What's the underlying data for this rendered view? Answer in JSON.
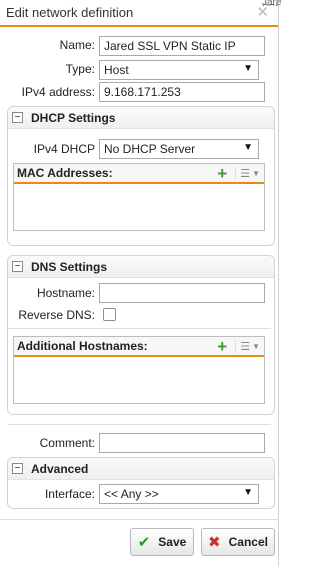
{
  "background_peek": "Jared SSL VP",
  "dialog": {
    "title": "Edit network definition",
    "close_icon": "close-icon"
  },
  "form": {
    "name_label": "Name:",
    "name_value": "Jared SSL VPN Static IP",
    "type_label": "Type:",
    "type_value": "Host",
    "ipv4_label": "IPv4 address:",
    "ipv4_value": "9.168.171.253"
  },
  "dhcp": {
    "toggle": "⊟",
    "title": "DHCP Settings",
    "ipv4_dhcp_label": "IPv4 DHCP",
    "ipv4_dhcp_value": "No DHCP Server",
    "mac_grid_title": "MAC Addresses:"
  },
  "dns": {
    "toggle": "⊟",
    "title": "DNS Settings",
    "hostname_label": "Hostname:",
    "hostname_value": "",
    "reverse_dns_label": "Reverse DNS:",
    "reverse_dns_checked": false,
    "additional_grid_title": "Additional Hostnames:"
  },
  "comment": {
    "label": "Comment:",
    "value": ""
  },
  "advanced": {
    "toggle": "⊟",
    "title": "Advanced",
    "interface_label": "Interface:",
    "interface_value": "<< Any >>"
  },
  "footer": {
    "save_label": "Save",
    "cancel_label": "Cancel"
  },
  "icons": {
    "plus": "+",
    "check": "✔",
    "cross": "✖",
    "close": "✕",
    "arrow": "▼",
    "list": "☰",
    "caret": "▼"
  },
  "colors": {
    "accent": "#e8891a",
    "add_green": "#3d9a2d",
    "cancel_red": "#d23030"
  }
}
